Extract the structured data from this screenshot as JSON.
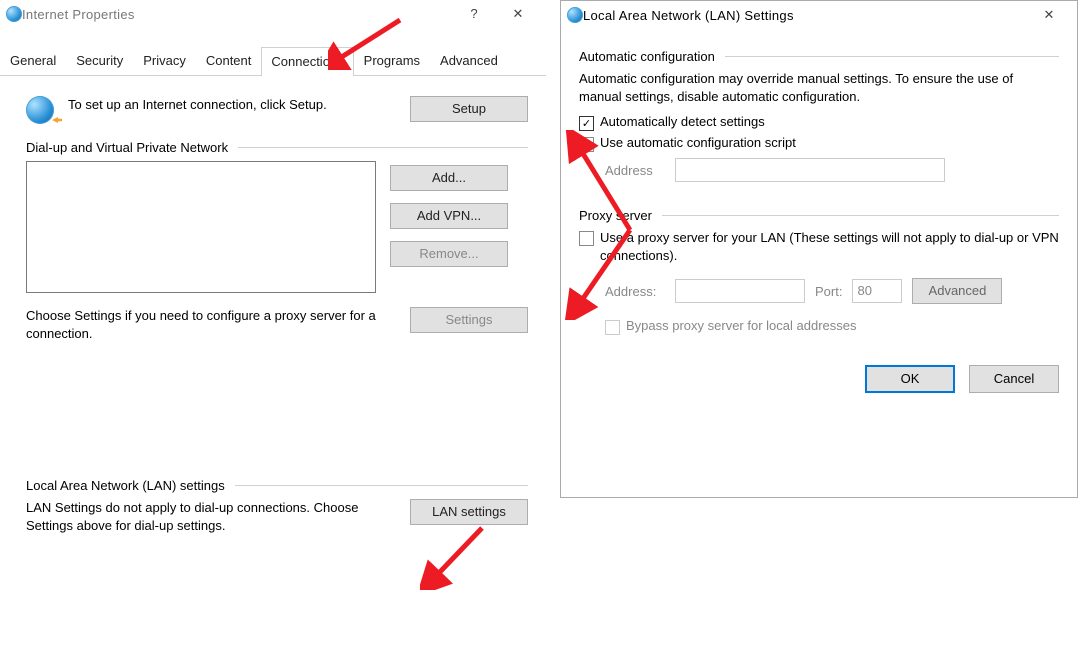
{
  "ip": {
    "title": "Internet Properties",
    "tabs": [
      "General",
      "Security",
      "Privacy",
      "Content",
      "Connections",
      "Programs",
      "Advanced"
    ],
    "active_tab": 4,
    "setup_text": "To set up an Internet connection, click Setup.",
    "setup_btn": "Setup",
    "group_dialup": "Dial-up and Virtual Private Network",
    "add_btn": "Add...",
    "addvpn_btn": "Add VPN...",
    "remove_btn": "Remove...",
    "settings_hint": "Choose Settings if you need to configure a proxy server for a connection.",
    "settings_btn": "Settings",
    "group_lan": "Local Area Network (LAN) settings",
    "lan_hint": "LAN Settings do not apply to dial-up connections. Choose Settings above for dial-up settings.",
    "lan_btn": "LAN settings"
  },
  "lan": {
    "title": "Local Area Network (LAN) Settings",
    "group_auto": "Automatic configuration",
    "auto_hint": "Automatic configuration may override manual settings.  To ensure the use of manual settings, disable automatic configuration.",
    "auto_detect": "Automatically detect settings",
    "auto_detect_checked": true,
    "auto_script": "Use automatic configuration script",
    "auto_script_checked": false,
    "address_label": "Address",
    "group_proxy": "Proxy server",
    "proxy_use": "Use a proxy server for your LAN (These settings will not apply to dial-up or VPN connections).",
    "proxy_checked": false,
    "addr_label": "Address:",
    "port_label": "Port:",
    "port_value": "80",
    "advanced_btn": "Advanced",
    "bypass": "Bypass proxy server for local addresses",
    "ok": "OK",
    "cancel": "Cancel"
  }
}
